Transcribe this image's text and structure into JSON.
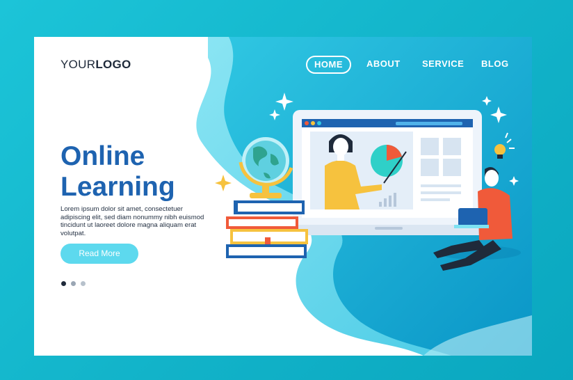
{
  "logo": {
    "prefix": "YOUR",
    "suffix": "LOGO"
  },
  "nav": {
    "items": [
      {
        "label": "HOME",
        "active": true
      },
      {
        "label": "ABOUT"
      },
      {
        "label": "SERVICE"
      },
      {
        "label": "BLOG"
      }
    ]
  },
  "hero": {
    "title_line1": "Online",
    "title_line2": "Learning",
    "description": "Lorem ipsum dolor sit amet, consectetuer adipiscing elit, sed diam nonummy nibh euismod tincidunt ut laoreet dolore magna aliquam erat volutpat.",
    "cta_label": "Read More"
  },
  "pagination": {
    "count": 3,
    "active_index": 0
  },
  "colors": {
    "background": "#12b3c9",
    "primary_blue": "#1e63b0",
    "button": "#5dd9ee",
    "accent_orange": "#f05a3a",
    "accent_yellow": "#f6c23e"
  },
  "icons": [
    "globe-icon",
    "books-icon",
    "laptop-icon",
    "pie-chart-icon",
    "bar-chart-icon",
    "lightbulb-icon",
    "sparkle-icon"
  ]
}
